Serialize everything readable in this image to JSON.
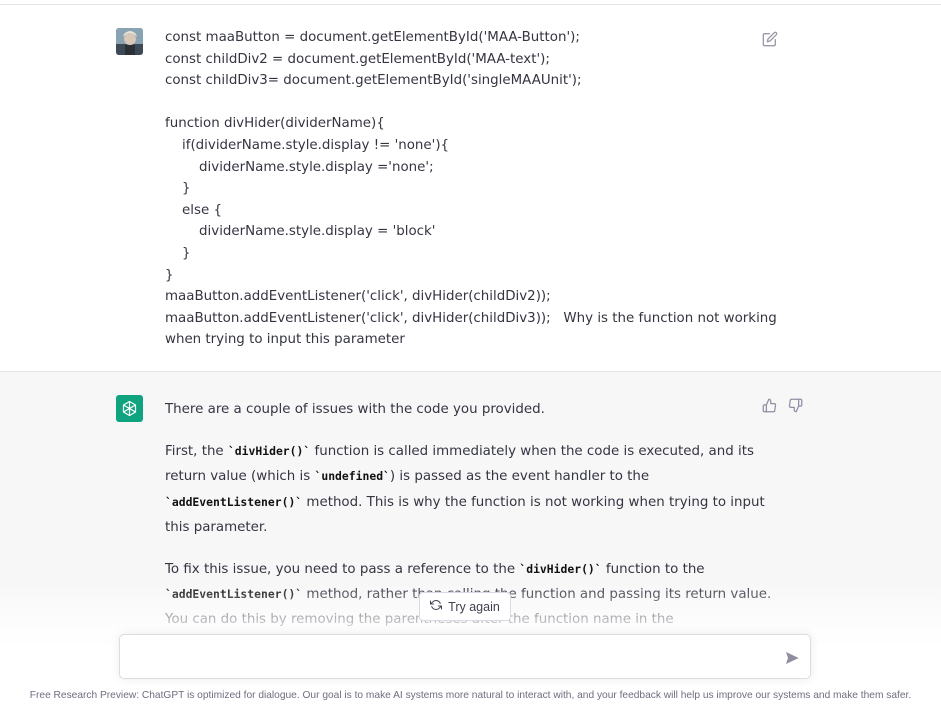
{
  "user_message": {
    "lines": [
      "const maaButton = document.getElementById('MAA-Button');",
      "const childDiv2 = document.getElementById('MAA-text');",
      "const childDiv3= document.getElementById('singleMAAUnit');",
      "",
      "function divHider(dividerName){",
      "    if(dividerName.style.display != 'none'){",
      "        dividerName.style.display ='none';",
      "    }",
      "    else {",
      "        dividerName.style.display = 'block'",
      "    }",
      "}",
      "maaButton.addEventListener('click', divHider(childDiv2));",
      "maaButton.addEventListener('click', divHider(childDiv3));   Why is the function not working",
      "when trying to input this parameter"
    ]
  },
  "assistant_message": {
    "p1": "There are a couple of issues with the code you provided.",
    "p2": {
      "l1a": "First, the ",
      "l1code": "`divHider()`",
      "l1b": " function is called immediately when the code is executed, and its",
      "l2a": "return value (which is ",
      "l2code": "`undefined`",
      "l2b": ") is passed as the event handler to the",
      "l3code": "`addEventListener()`",
      "l3b": " method. This is why the function is not working when trying to input",
      "l4": "this parameter."
    },
    "p3": {
      "l1a": "To fix this issue, you need to pass a reference to the ",
      "l1code": "`divHider()`",
      "l1b": " function to the",
      "l2code": "`addEventListener()`",
      "l2b": " method, rather than calling the function and passing its return value.",
      "l3": "You can do this by removing the parentheses after the function name in the"
    }
  },
  "try_again_label": "Try again",
  "input": {
    "placeholder": ""
  },
  "footer_text": "Free Research Preview: ChatGPT is optimized for dialogue. Our goal is to make AI systems more natural to interact with, and your feedback will help us improve our systems and make them safer.",
  "colors": {
    "accent": "#10a37f",
    "assistant_bg": "#f7f7f8"
  },
  "icons": [
    "edit-icon",
    "openai-logo-icon",
    "thumbs-up-icon",
    "thumbs-down-icon",
    "refresh-icon",
    "send-icon"
  ]
}
